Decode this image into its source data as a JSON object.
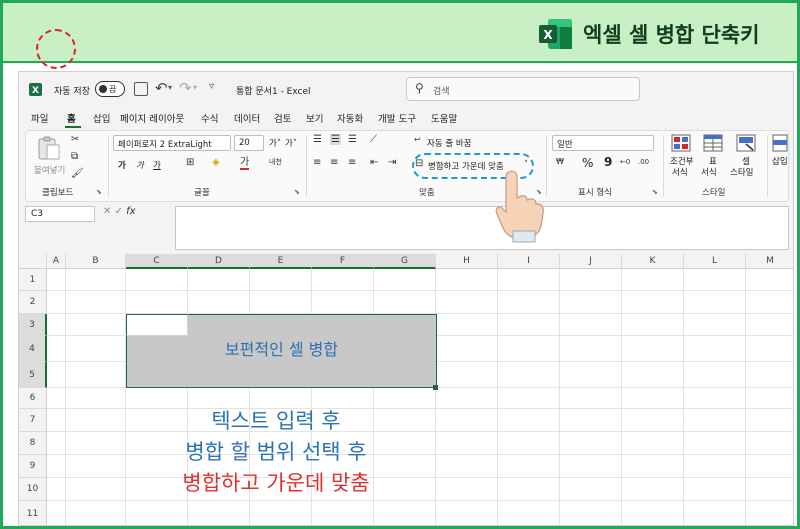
{
  "banner": {
    "title": "엑셀 셀 병합 단축키",
    "logo_letter": "X"
  },
  "titlebar": {
    "autosave_label": "자동 저장",
    "autosave_state": "끔",
    "document_title": "통합 문서1  -  Excel",
    "search_placeholder": "검색"
  },
  "menu": {
    "tabs": [
      "파일",
      "홈",
      "삽입",
      "페이지 레이아웃",
      "수식",
      "데이터",
      "검토",
      "보기",
      "자동화",
      "개발 도구",
      "도움말"
    ],
    "active_tab": "홈"
  },
  "ribbon": {
    "clipboard": {
      "paste": "붙여넣기",
      "label": "클립보드"
    },
    "font": {
      "name": "페이퍼로지 2 ExtraLight",
      "size": "20",
      "grow": "가˄",
      "shrink": "가˅",
      "bold": "가",
      "italic": "가",
      "underline": "가",
      "label": "글꼴"
    },
    "alignment": {
      "wrap_text": "자동 줄 바꿈",
      "merge_center": "병합하고 가운데 맞춤",
      "label": "맞춤"
    },
    "number": {
      "format": "일반",
      "label": "표시 형식",
      "percent": "%",
      "comma": "9"
    },
    "styles": {
      "conditional": "조건부\n서식",
      "conditional_1": "조건부",
      "conditional_2": "서식",
      "table_1": "표",
      "table_2": "서식",
      "cell_1": "셀",
      "cell_2": "스타일",
      "label": "스타일"
    },
    "cells": {
      "insert": "삽입"
    }
  },
  "formula_bar": {
    "name_box": "C3",
    "fx": "fx",
    "value": ""
  },
  "sheet": {
    "columns": [
      "A",
      "B",
      "C",
      "D",
      "E",
      "F",
      "G",
      "H",
      "I",
      "J",
      "K",
      "L",
      "M"
    ],
    "rows": [
      "1",
      "2",
      "3",
      "4",
      "5",
      "6",
      "7",
      "8",
      "9",
      "10",
      "11"
    ],
    "merged_text": "보편적인 셀 병합"
  },
  "instructions": {
    "line1": "텍스트 입력 후",
    "line2": "병합 할 범위 선택 후",
    "line3": "병합하고 가운데 맞춤"
  },
  "colors": {
    "accent": "#21a85a",
    "excel_green": "#1e6b3a",
    "highlight_red": "#d6262b",
    "highlight_blue": "#1a9bd6"
  }
}
